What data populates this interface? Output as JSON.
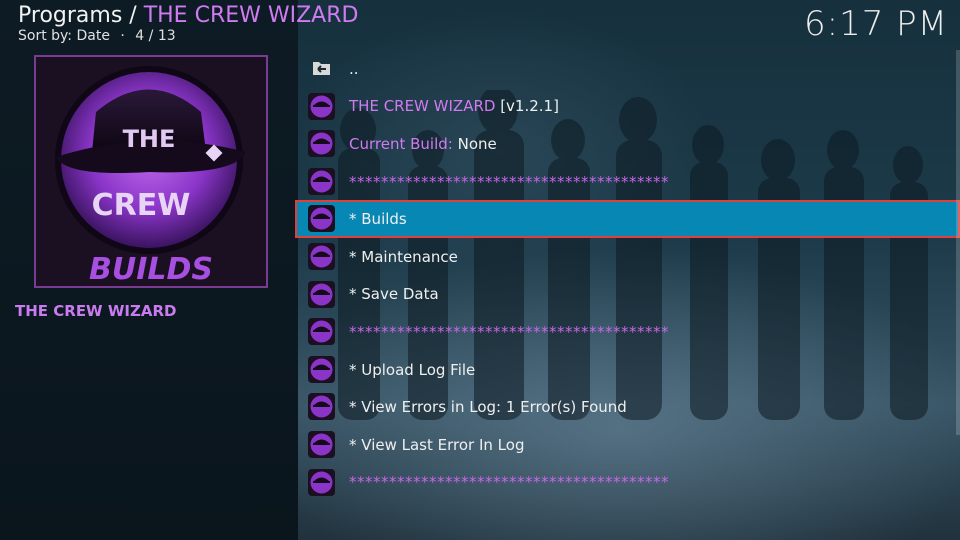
{
  "header": {
    "section": "Programs",
    "separator": " / ",
    "addon": "THE CREW WIZARD",
    "sort_label": "Sort by: Date",
    "bullet": "·",
    "position": "4 / 13",
    "clock": "6:17 PM"
  },
  "thumbnail": {
    "logo_text_top": "THE",
    "logo_text_mid": "CREW",
    "logo_text_bottom": "BUILDS",
    "caption": "THE CREW WIZARD"
  },
  "list": {
    "parent": "..",
    "title_name": "THE CREW WIZARD",
    "title_version": " [v1.2.1]",
    "build_label": "Current Build:",
    "build_value": " None",
    "separator": "****************************************",
    "builds": "*  Builds",
    "maintenance": "*  Maintenance",
    "save_data": "*  Save Data",
    "upload_log": "*  Upload Log File",
    "view_errors": "*  View Errors in Log: 1 Error(s) Found",
    "view_last_error": "*  View Last Error In Log"
  },
  "colors": {
    "accent_purple": "#d07bf2",
    "selection_blue": "#0787b4",
    "selection_outline": "#e0403c"
  }
}
